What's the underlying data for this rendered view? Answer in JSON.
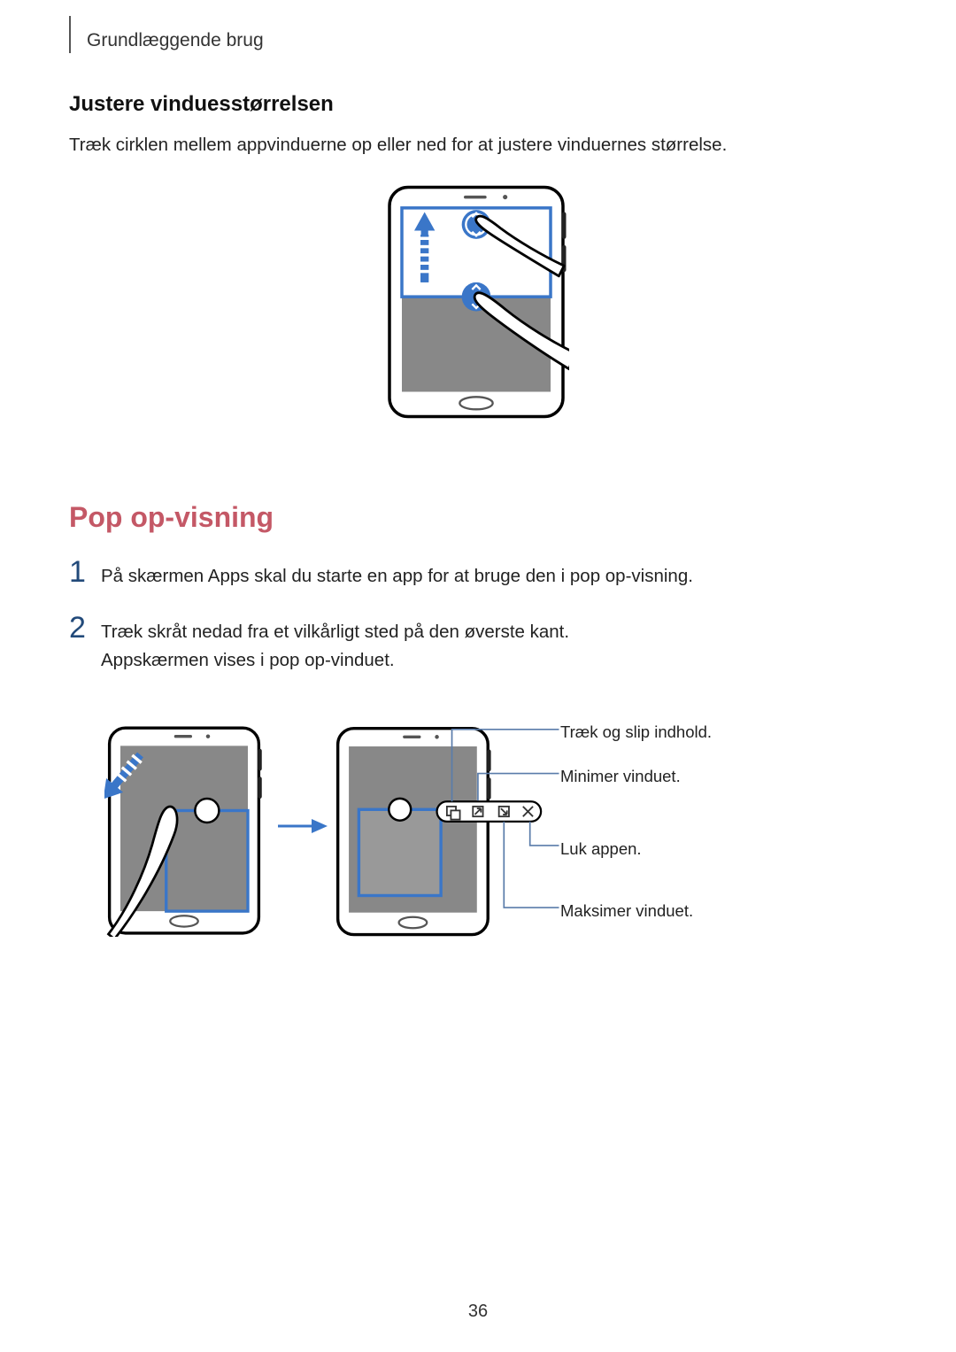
{
  "header": "Grundlæggende brug",
  "subheading": "Justere vinduesstørrelsen",
  "paragraph1": "Træk cirklen mellem appvinduerne op eller ned for at justere vinduernes størrelse.",
  "heading2": "Pop op-visning",
  "steps": [
    {
      "num": "1",
      "text": "På skærmen Apps skal du starte en app for at bruge den i pop op-visning."
    },
    {
      "num": "2",
      "text": "Træk skråt nedad fra et vilkårligt sted på den øverste kant.",
      "text2": "Appskærmen vises i pop op-vinduet."
    }
  ],
  "callouts": {
    "drag": "Træk og slip indhold.",
    "min": "Minimer vinduet.",
    "close": "Luk appen.",
    "max": "Maksimer vinduet."
  },
  "page_number": "36"
}
